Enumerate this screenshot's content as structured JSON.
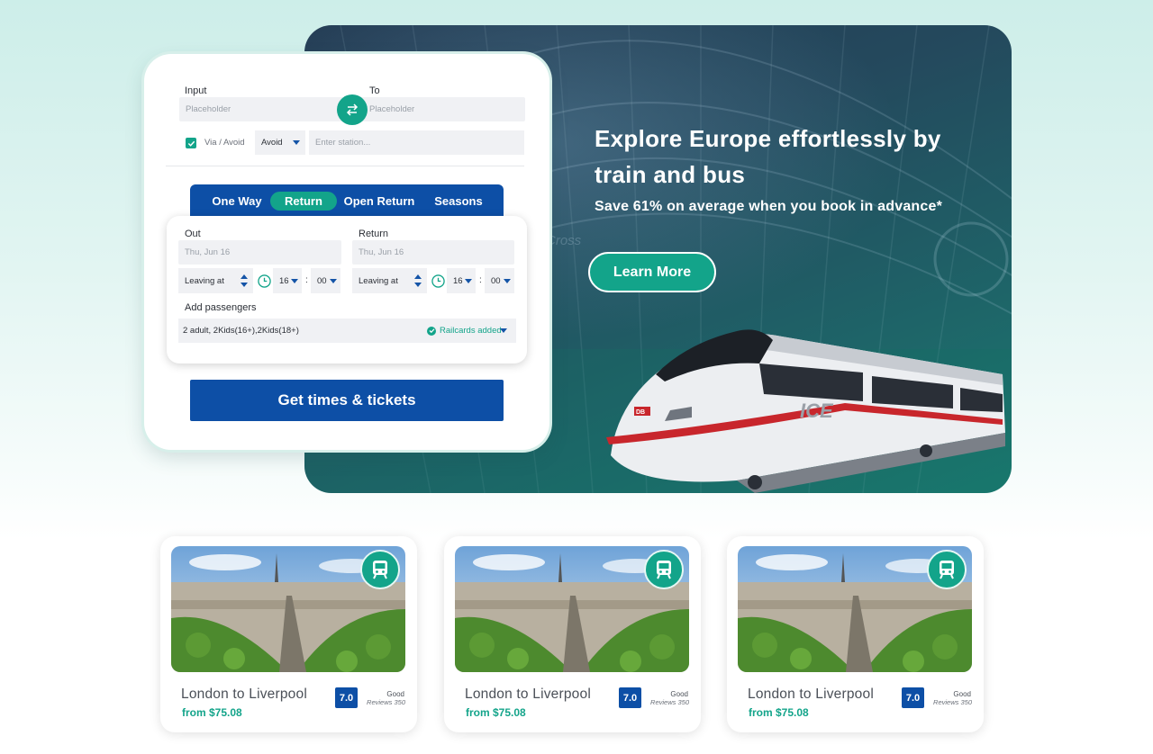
{
  "hero": {
    "title": "Explore Europe effortlessly by train and bus",
    "subtitle": "Save 61% on average when you book in advance*",
    "cta": "Learn More"
  },
  "search": {
    "from_label": "Input",
    "from_placeholder": "Placeholder",
    "to_label": "To",
    "to_placeholder": "Placeholder",
    "via_label": "Via / Avoid",
    "via_checked": true,
    "avoid_value": "Avoid",
    "station_placeholder": "Enter station...",
    "tabs": [
      {
        "label": "One Way",
        "active": false
      },
      {
        "label": "Return",
        "active": true
      },
      {
        "label": "Open Return",
        "active": false
      },
      {
        "label": "Seasons",
        "active": false
      }
    ],
    "out": {
      "label": "Out",
      "date": "Thu, Jun 16",
      "leaving": "Leaving at",
      "hour": "16",
      "minute": "00"
    },
    "return": {
      "label": "Return",
      "date": "Thu, Jun 16",
      "leaving": "Leaving at",
      "hour": "16",
      "minute": "00"
    },
    "passengers_label": "Add passengers",
    "passengers_value": "2 adult, 2Kids(16+),2Kids(18+)",
    "railcards": "Railcards added",
    "submit": "Get times & tickets"
  },
  "cards": [
    {
      "title": "London to Liverpool",
      "price": "from $75.08",
      "score": "7.0",
      "rating": "Good",
      "reviews": "Reviews 350"
    },
    {
      "title": "London to Liverpool",
      "price": "from $75.08",
      "score": "7.0",
      "rating": "Good",
      "reviews": "Reviews 350"
    },
    {
      "title": "London to Liverpool",
      "price": "from $75.08",
      "score": "7.0",
      "rating": "Good",
      "reviews": "Reviews 350"
    }
  ],
  "colors": {
    "accent": "#13a48a",
    "primary": "#0d4fa6",
    "field_bg": "#f0f1f4"
  }
}
